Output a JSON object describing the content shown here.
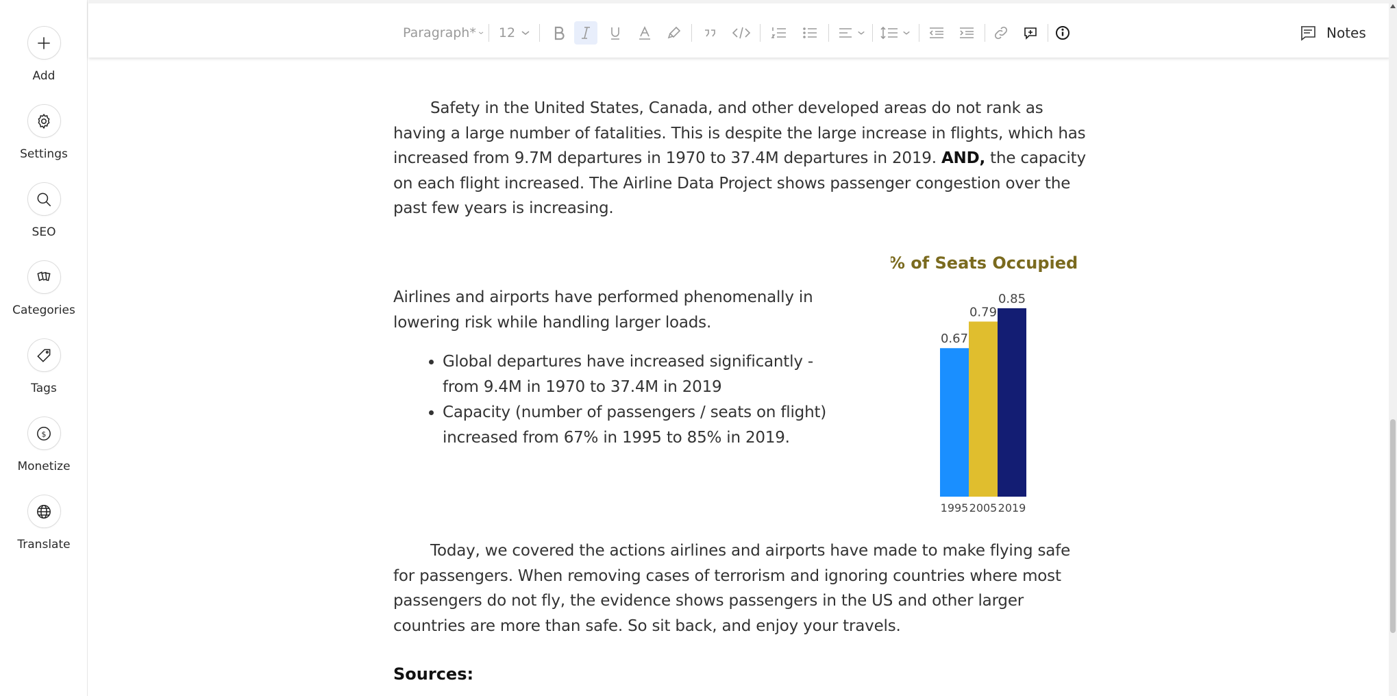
{
  "sidebar": {
    "items": [
      {
        "label": "Add",
        "icon": "plus-icon"
      },
      {
        "label": "Settings",
        "icon": "gear-icon"
      },
      {
        "label": "SEO",
        "icon": "search-icon"
      },
      {
        "label": "Categories",
        "icon": "categories-icon"
      },
      {
        "label": "Tags",
        "icon": "tag-icon"
      },
      {
        "label": "Monetize",
        "icon": "dollar-icon"
      },
      {
        "label": "Translate",
        "icon": "globe-icon"
      }
    ]
  },
  "toolbar": {
    "paragraph_style": "Paragraph*",
    "font_size": "12",
    "notes_label": "Notes"
  },
  "content": {
    "p1_before_bold": "Safety in the United States, Canada, and other developed areas do not rank as having a large number of fatalities. This is despite the large increase in flights, which has increased from 9.7M departures in 1970 to 37.4M departures in 2019. ",
    "p1_bold": "AND,",
    "p1_after_bold": " the capacity on each flight increased. The Airline Data Project shows passenger congestion over the past few years is increasing.",
    "p2": "Airlines and airports have performed phenomenally in lowering risk while handling larger loads.",
    "bullets": [
      "Global departures have increased significantly - from 9.4M in 1970 to 37.4M in 2019",
      "Capacity (number of passengers / seats on flight) increased from 67% in 1995 to 85% in 2019."
    ],
    "p3": "Today, we covered the actions airlines and airports have made to make flying safe for passengers. When removing cases of terrorism and ignoring countries where most passengers do not fly, the evidence shows passengers in the US and other larger countries are more than safe. So sit back, and enjoy your travels.",
    "sources_heading": "Sources:"
  },
  "chart_data": {
    "type": "bar",
    "title": "% of Seats Occupied",
    "categories": [
      "1995",
      "2005",
      "2019"
    ],
    "values": [
      0.67,
      0.79,
      0.85
    ],
    "data_labels": [
      "0.67",
      "0.79",
      "0.85"
    ],
    "colors": [
      "#1a8fff",
      "#e0be2e",
      "#131d73"
    ],
    "title_color": "#7a6a1e",
    "ylim": [
      0,
      0.85
    ],
    "grid": false
  }
}
